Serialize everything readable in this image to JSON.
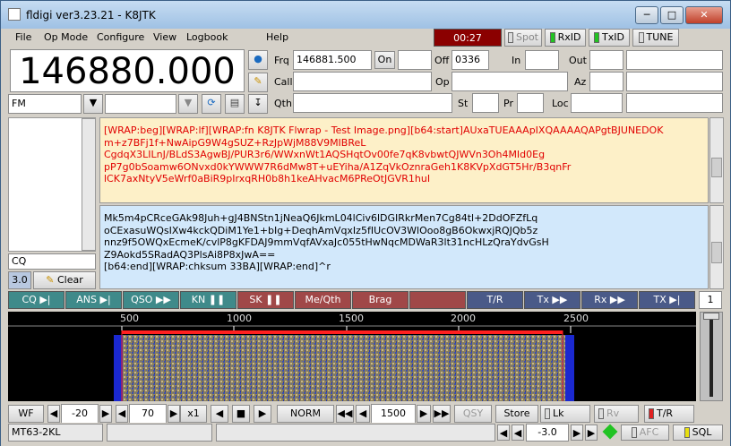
{
  "title": "fldigi ver3.23.21 - K8JTK",
  "menu": [
    "File",
    "Op Mode",
    "Configure",
    "View",
    "Logbook",
    "Help"
  ],
  "timer": "00:27",
  "toggles": {
    "spot": "Spot",
    "rxid": "RxID",
    "txid": "TxID",
    "tune": "TUNE"
  },
  "frequency": "146880.000",
  "mode": "FM",
  "log": {
    "frq_label": "Frq",
    "frq": "146881.500",
    "on_label": "On",
    "off_label": "Off",
    "off": "0336",
    "in_label": "In",
    "out_label": "Out",
    "call_label": "Call",
    "op_label": "Op",
    "az_label": "Az",
    "qth_label": "Qth",
    "st_label": "St",
    "pr_label": "Pr",
    "loc_label": "Loc"
  },
  "rx_lines": [
    "[WRAP:beg][WRAP:lf][WRAP:fn K8JTK Flwrap - Test Image.png][b64:start]AUxaTUEAAApIXQAAAAQAPgtBJUNEDOK",
    "m+z7BFj1f+NwAipG9W4gSUZ+RzJpWjM88V9MIBReL",
    "CgdqX3LILnJ/BLdS3AgwBJ/PUR3r6/WWxnWt1AQSHqtOv00fe7qK8vbwtQJWVn3Oh4MId0Eg",
    "pP7g0bSoamw6ONvxd0kYWWW7R6dMw8T+uEYiha/A1ZqVkOznraGeh1K8KVpXdGT5Hr/B3qnFr",
    "lCK7axNtyV5eWrf0aBiR9pIrxqRH0b8h1keAHvacM6PReOtJGVR1huI"
  ],
  "tx_lines": [
    "Mk5m4pCRceGAk98Juh+gJ4BNStn1jNeaQ6JkmL04lCiv6lDGIRkrMen7Cg84tl+2DdOFZfLq",
    "oCExasuWQsIXw4kckQDiM1Ye1+bIg+DeqhAmVqxIz5fIUcOV3WlOoo8gB6OkwxjRQJQb5z",
    "nnz9f5OWQxEcmeK/cvlP8gKFDAJ9mmVqfAVxaJc055tHwNqcMDWaR3lt31ncHLzQraYdvGsH",
    "Z9Aokd5SRadAQ3PlsAi8P8xJwA==",
    "[b64:end][WRAP:chksum 33BA][WRAP:end]^r"
  ],
  "left_field": "CQ",
  "level": "3.0",
  "clear_label": "Clear",
  "macros": [
    "CQ",
    "ANS",
    "QSO",
    "KN",
    "SK",
    "Me/Qth",
    "Brag",
    "",
    "T/R",
    "Tx",
    "Rx",
    "TX"
  ],
  "macro_set": "1",
  "scale_labels": [
    "500",
    "1000",
    "1500",
    "2000",
    "2500"
  ],
  "controls": {
    "wf": "WF",
    "ref": "-20",
    "range": "70",
    "zoom": "x1",
    "norm": "NORM",
    "carrier": "1500",
    "qsy": "QSY",
    "store": "Store",
    "lk": "Lk",
    "rv": "Rv",
    "tr": "T/R"
  },
  "status": {
    "mode": "MT63-2KL",
    "metric": "-3.0",
    "afc": "AFC",
    "sql": "SQL"
  },
  "colors": {
    "rx_text": "#e10000",
    "rx_bg": "#fdf0c8",
    "tx_bg": "#d2e8fb",
    "timer_bg": "#8b0000",
    "led_green": "#22c322",
    "led_red": "#e02020",
    "led_yellow": "#e8e010"
  }
}
